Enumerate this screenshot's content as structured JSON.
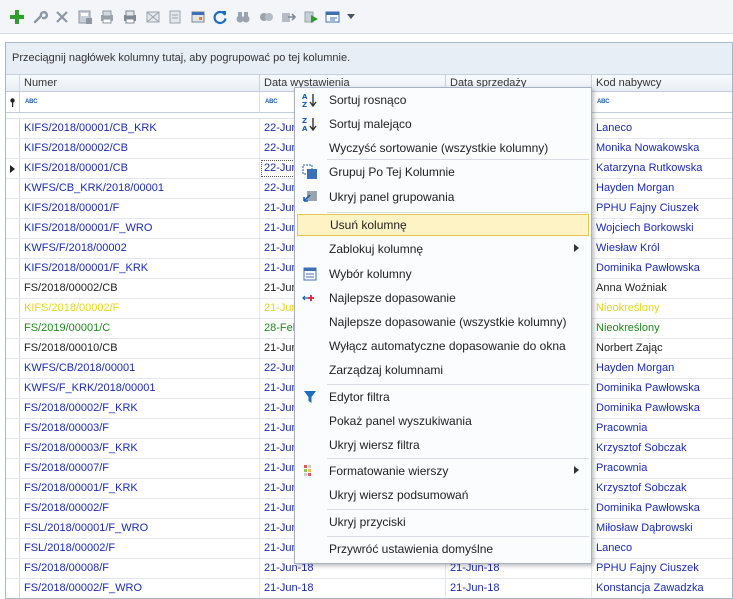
{
  "toolbar": {
    "icons": [
      "add-icon",
      "wrench-icon",
      "delete-icon",
      "calculator-icon",
      "print-preview-icon",
      "print-icon",
      "envelope-icon",
      "document-icon",
      "card-icon",
      "refresh-icon",
      "binoculars-icon",
      "filter-icon",
      "export-icon",
      "play-icon",
      "view-icon"
    ],
    "colors": {
      "add": "#2e9e2e",
      "refresh": "#1a6fc4"
    }
  },
  "grid": {
    "group_hint": "Przeciągnij nagłówek kolumny tutaj, aby pogrupować po tej kolumnie.",
    "columns": [
      "Numer",
      "Data wystawienia",
      "Data sprzedaży",
      "Kod nabywcy"
    ],
    "filter_token": "ABC",
    "rows": [
      {
        "numer": "KIFS/2018/00001/CB_KRK",
        "data": "22-Jun",
        "data2": "",
        "kod": "Laneco",
        "color": "#1b2bb5"
      },
      {
        "numer": "KIFS/2018/00002/CB",
        "data": "22-Jun",
        "data2": "",
        "kod": "Monika Nowakowska",
        "color": "#1b2bb5"
      },
      {
        "numer": "KIFS/2018/00001/CB",
        "data": "22-Jun",
        "data2": "",
        "kod": "Katarzyna Rutkowska",
        "color": "#1b2bb5",
        "selected": true
      },
      {
        "numer": "KWFS/CB_KRK/2018/00001",
        "data": "22-Jun",
        "data2": "",
        "kod": "Hayden Morgan",
        "color": "#1b2bb5"
      },
      {
        "numer": "KIFS/2018/00001/F",
        "data": "21-Jun",
        "data2": "",
        "kod": "PPHU Fajny Ciuszek",
        "color": "#1b2bb5"
      },
      {
        "numer": "KIFS/2018/00001/F_WRO",
        "data": "21-Jun",
        "data2": "",
        "kod": "Wojciech Borkowski",
        "color": "#1b2bb5"
      },
      {
        "numer": "KWFS/F/2018/00002",
        "data": "21-Jun",
        "data2": "",
        "kod": "Wiesław Król",
        "color": "#1b2bb5"
      },
      {
        "numer": "KIFS/2018/00001/F_KRK",
        "data": "21-Jun",
        "data2": "",
        "kod": "Dominika Pawłowska",
        "color": "#1b2bb5"
      },
      {
        "numer": "FS/2018/00002/CB",
        "data": "21-Jun",
        "data2": "",
        "kod": "Anna Woźniak",
        "color": "#222222"
      },
      {
        "numer": "KIFS/2018/00002/F",
        "data": "21-Jun",
        "data2": "",
        "kod": "Nieokreślony",
        "color": "#e6d619"
      },
      {
        "numer": "FS/2019/00001/C",
        "data": "28-Feb",
        "data2": "",
        "kod": "Nieokreślony",
        "color": "#1e8a1e"
      },
      {
        "numer": "FS/2018/00010/CB",
        "data": "21-Jun",
        "data2": "",
        "kod": "Norbert Zając",
        "color": "#222222"
      },
      {
        "numer": "KWFS/CB/2018/00001",
        "data": "22-Jun",
        "data2": "",
        "kod": "Hayden Morgan",
        "color": "#1b2bb5"
      },
      {
        "numer": "KWFS/F_KRK/2018/00001",
        "data": "21-Jun",
        "data2": "",
        "kod": "Dominika Pawłowska",
        "color": "#1b2bb5"
      },
      {
        "numer": "FS/2018/00002/F_KRK",
        "data": "21-Jun",
        "data2": "",
        "kod": "Dominika Pawłowska",
        "color": "#1b2bb5"
      },
      {
        "numer": "FS/2018/00003/F",
        "data": "21-Jun",
        "data2": "",
        "kod": "Pracownia",
        "color": "#1b2bb5"
      },
      {
        "numer": "FS/2018/00003/F_KRK",
        "data": "21-Jun",
        "data2": "",
        "kod": "Krzysztof Sobczak",
        "color": "#1b2bb5"
      },
      {
        "numer": "FS/2018/00007/F",
        "data": "21-Jun",
        "data2": "",
        "kod": "Pracownia",
        "color": "#1b2bb5"
      },
      {
        "numer": "FS/2018/00001/F_KRK",
        "data": "21-Jun",
        "data2": "",
        "kod": "Krzysztof Sobczak",
        "color": "#1b2bb5"
      },
      {
        "numer": "FS/2018/00002/F",
        "data": "21-Jun",
        "data2": "",
        "kod": "Dominika Pawłowska",
        "color": "#1b2bb5"
      },
      {
        "numer": "FSL/2018/00001/F_WRO",
        "data": "21-Jun",
        "data2": "",
        "kod": "Miłosław Dąbrowski",
        "color": "#1b2bb5"
      },
      {
        "numer": "FSL/2018/00002/F",
        "data": "21-Jun",
        "data2": "",
        "kod": "Laneco",
        "color": "#1b2bb5"
      },
      {
        "numer": "FS/2018/00008/F",
        "data": "21-Jun-18",
        "data2": "21-Jun-18",
        "kod": "PPHU Fajny Ciuszek",
        "color": "#1b2bb5"
      },
      {
        "numer": "FS/2018/00002/F_WRO",
        "data": "21-Jun-18",
        "data2": "21-Jun-18",
        "kod": "Konstancja Zawadzka",
        "color": "#1b2bb5"
      }
    ]
  },
  "context_menu": {
    "items": [
      {
        "label": "Sortuj rosnąco",
        "icon": "sort-ascending-icon"
      },
      {
        "label": "Sortuj malejąco",
        "icon": "sort-descending-icon"
      },
      {
        "label": "Wyczyść sortowanie (wszystkie kolumny)",
        "icon": ""
      },
      {
        "label": "Grupuj Po Tej Kolumnie",
        "icon": "group-by-icon",
        "sep_before": true
      },
      {
        "label": "Ukryj panel grupowania",
        "icon": "group-panel-icon"
      },
      {
        "label": "Usuń kolumnę",
        "icon": "",
        "sep_before": true,
        "highlighted": true
      },
      {
        "label": "Zablokuj kolumnę",
        "icon": "",
        "submenu": true
      },
      {
        "label": "Wybór kolumny",
        "icon": "column-chooser-icon"
      },
      {
        "label": "Najlepsze dopasowanie",
        "icon": "best-fit-icon"
      },
      {
        "label": "Najlepsze dopasowanie (wszystkie kolumny)",
        "icon": ""
      },
      {
        "label": "Wyłącz automatyczne dopasowanie do okna",
        "icon": ""
      },
      {
        "label": "Zarządzaj kolumnami",
        "icon": ""
      },
      {
        "label": "Edytor filtra",
        "icon": "filter-funnel-icon",
        "sep_before": true
      },
      {
        "label": "Pokaż panel wyszukiwania",
        "icon": ""
      },
      {
        "label": "Ukryj wiersz filtra",
        "icon": ""
      },
      {
        "label": "Formatowanie wierszy",
        "icon": "conditional-format-icon",
        "sep_before": true,
        "submenu": true
      },
      {
        "label": "Ukryj wiersz podsumowań",
        "icon": ""
      },
      {
        "label": "Ukryj przyciski",
        "icon": "",
        "sep_before": true
      },
      {
        "label": "Przywróć ustawienia domyślne",
        "icon": "",
        "sep_before": true
      }
    ],
    "colors": {
      "highlight": "#fdf3c4",
      "highlight_border": "#e6c84f"
    }
  }
}
